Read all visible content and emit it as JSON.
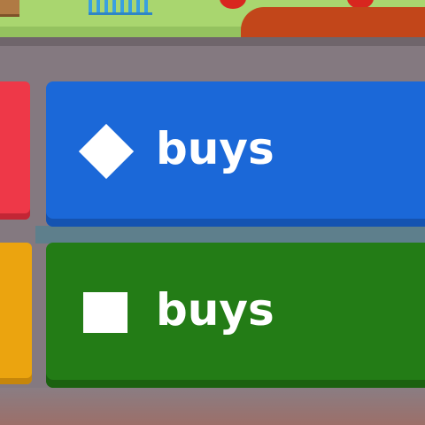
{
  "actions": [
    {
      "label": "buys",
      "icon": "diamond-icon",
      "color": "#1b68d8"
    },
    {
      "label": "buys",
      "icon": "square-icon",
      "color": "#237c16"
    }
  ],
  "side_tiles": [
    {
      "color": "#ee3848"
    },
    {
      "color": "#eba40f"
    }
  ]
}
